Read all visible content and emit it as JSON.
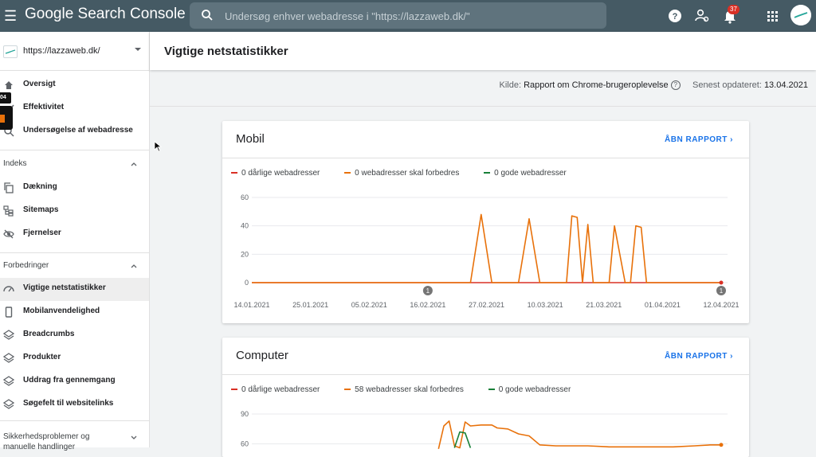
{
  "app": {
    "title": "Google Search Console"
  },
  "search": {
    "placeholder": "Undersøg enhver webadresse i \"https://lazzaweb.dk/\""
  },
  "notifications": {
    "count": "37"
  },
  "property": {
    "label": "https://lazzaweb.dk/"
  },
  "sidebar": {
    "items_top": [
      {
        "label": "Oversigt",
        "icon": "home-icon"
      },
      {
        "label": "Effektivitet",
        "icon": "trend-icon"
      },
      {
        "label": "Undersøgelse af webadresse",
        "icon": "search-icon"
      }
    ],
    "section_index": "Indeks",
    "items_index": [
      {
        "label": "Dækning",
        "icon": "copy-icon"
      },
      {
        "label": "Sitemaps",
        "icon": "sitemap-icon"
      },
      {
        "label": "Fjernelser",
        "icon": "eye-off-icon"
      }
    ],
    "section_improvements": "Forbedringer",
    "items_improvements": [
      {
        "label": "Vigtige netstatistikker",
        "icon": "gauge-icon"
      },
      {
        "label": "Mobilanvendelighed",
        "icon": "phone-icon"
      },
      {
        "label": "Breadcrumbs",
        "icon": "layers-icon"
      },
      {
        "label": "Produkter",
        "icon": "layers-icon"
      },
      {
        "label": "Uddrag fra gennemgang",
        "icon": "layers-icon"
      },
      {
        "label": "Søgefelt til websitelinks",
        "icon": "layers-icon"
      }
    ],
    "section_security": "Sikkerhedsproblemer og manuelle handlinger",
    "overlay_badge": "04"
  },
  "page": {
    "title": "Vigtige netstatistikker",
    "source_label": "Kilde:",
    "source_value": "Rapport om Chrome-brugeroplevelse",
    "updated_label": "Senest opdateret:",
    "updated_value": "13.04.2021"
  },
  "colors": {
    "bad": "#d93025",
    "needs": "#e8710a",
    "good": "#188038",
    "accent": "#1a73e8",
    "topbar": "#455a64"
  },
  "cards": [
    {
      "title": "Mobil",
      "link": "ÅBN RAPPORT",
      "legend": [
        "0 dårlige webadresser",
        "0 webadresser skal forbedres",
        "0 gode webadresser"
      ]
    },
    {
      "title": "Computer",
      "link": "ÅBN RAPPORT",
      "legend": [
        "0 dårlige webadresser",
        "58 webadresser skal forbedres",
        "0 gode webadresser"
      ]
    }
  ],
  "chart_data": [
    {
      "type": "line",
      "title": "Mobil",
      "x_ticks": [
        "14.01.2021",
        "25.01.2021",
        "05.02.2021",
        "16.02.2021",
        "27.02.2021",
        "10.03.2021",
        "21.03.2021",
        "01.04.2021",
        "12.04.2021"
      ],
      "x_domain": [
        "2021-01-14",
        "2021-04-12"
      ],
      "ylim": [
        0,
        60
      ],
      "y_ticks": [
        0,
        20,
        40,
        60
      ],
      "grid": true,
      "annotations": [
        {
          "date": "2021-02-16",
          "label": "1"
        },
        {
          "date": "2021-04-12",
          "label": "1"
        }
      ],
      "series": [
        {
          "name": "0 dårlige webadresser",
          "color": "#d93025",
          "points": [
            [
              "2021-01-14",
              0
            ],
            [
              "2021-04-12",
              0
            ]
          ]
        },
        {
          "name": "0 webadresser skal forbedres",
          "color": "#e8710a",
          "points": [
            [
              "2021-01-14",
              0
            ],
            [
              "2021-02-24",
              0
            ],
            [
              "2021-02-26",
              48
            ],
            [
              "2021-02-28",
              0
            ],
            [
              "2021-03-05",
              0
            ],
            [
              "2021-03-07",
              45
            ],
            [
              "2021-03-09",
              0
            ],
            [
              "2021-03-14",
              0
            ],
            [
              "2021-03-15",
              47
            ],
            [
              "2021-03-16",
              46
            ],
            [
              "2021-03-17",
              0
            ],
            [
              "2021-03-18",
              41
            ],
            [
              "2021-03-19",
              0
            ],
            [
              "2021-03-22",
              0
            ],
            [
              "2021-03-23",
              40
            ],
            [
              "2021-03-25",
              0
            ],
            [
              "2021-03-26",
              0
            ],
            [
              "2021-03-27",
              40
            ],
            [
              "2021-03-28",
              39
            ],
            [
              "2021-03-29",
              0
            ],
            [
              "2021-04-12",
              0
            ]
          ]
        },
        {
          "name": "0 gode webadresser",
          "color": "#188038",
          "points": []
        }
      ]
    },
    {
      "type": "line",
      "title": "Computer",
      "x_domain": [
        "2021-01-14",
        "2021-04-12"
      ],
      "ylim": [
        50,
        90
      ],
      "y_ticks": [
        60,
        90
      ],
      "grid": true,
      "series": [
        {
          "name": "58 webadresser skal forbedres",
          "color": "#e8710a",
          "points": [
            [
              "2021-02-18",
              55
            ],
            [
              "2021-02-19",
              78
            ],
            [
              "2021-02-20",
              83
            ],
            [
              "2021-02-21",
              58
            ],
            [
              "2021-02-22",
              56
            ],
            [
              "2021-02-23",
              82
            ],
            [
              "2021-02-24",
              78
            ],
            [
              "2021-02-26",
              79
            ],
            [
              "2021-02-28",
              79
            ],
            [
              "2021-03-01",
              76
            ],
            [
              "2021-03-03",
              75
            ],
            [
              "2021-03-05",
              70
            ],
            [
              "2021-03-07",
              68
            ],
            [
              "2021-03-09",
              59
            ],
            [
              "2021-03-12",
              58
            ],
            [
              "2021-03-15",
              58
            ],
            [
              "2021-03-18",
              58
            ],
            [
              "2021-03-22",
              57
            ],
            [
              "2021-03-26",
              57
            ],
            [
              "2021-03-30",
              57
            ],
            [
              "2021-04-03",
              57
            ],
            [
              "2021-04-07",
              58
            ],
            [
              "2021-04-10",
              59
            ],
            [
              "2021-04-12",
              59
            ]
          ]
        },
        {
          "name": "0 gode webadresser",
          "color": "#188038",
          "points": [
            [
              "2021-02-21",
              56
            ],
            [
              "2021-02-22",
              72
            ],
            [
              "2021-02-23",
              71
            ],
            [
              "2021-02-24",
              56
            ]
          ]
        }
      ]
    }
  ]
}
